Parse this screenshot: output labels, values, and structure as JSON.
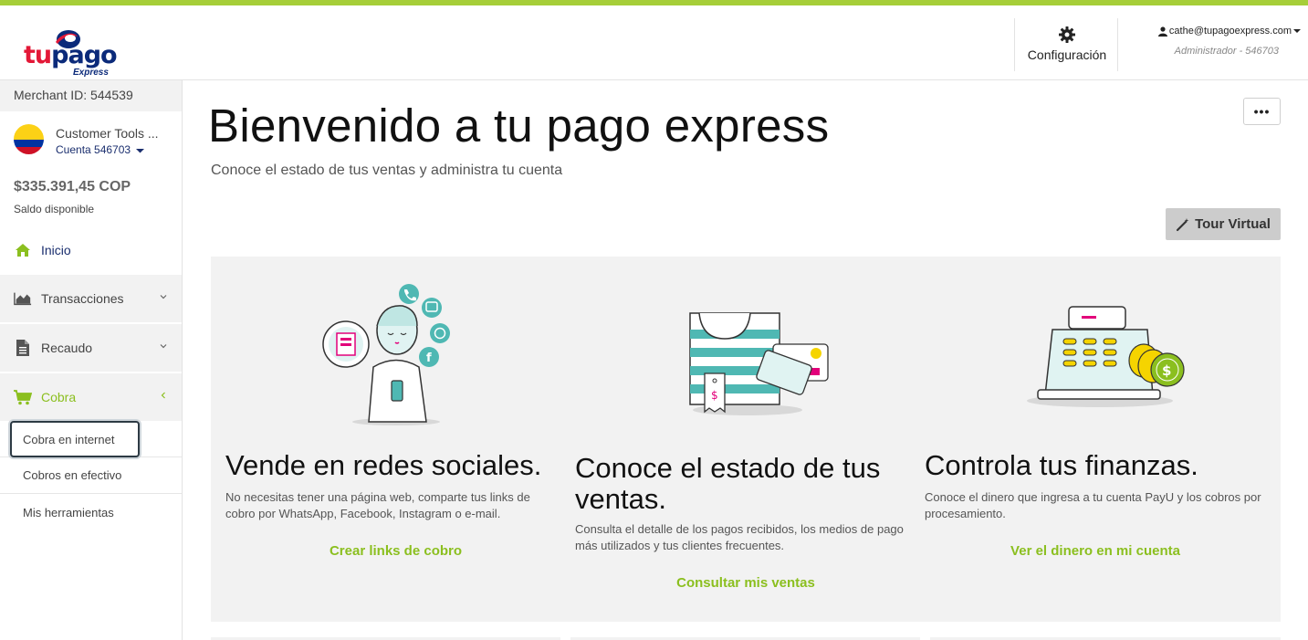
{
  "colors": {
    "accent": "#a6ce39",
    "brand_green": "#8bbf1f",
    "brand_navy": "#1a2e6e",
    "logo_red": "#e31837",
    "teal": "#4fb8b3"
  },
  "header": {
    "logo": {
      "tu": "tu",
      "pago": "pago",
      "express": "Express"
    },
    "config_label": "Configuración",
    "user_email": "cathe@tupagoexpress.com",
    "user_role": "Administrador - 546703"
  },
  "sidebar": {
    "merchant": "Merchant ID: 544539",
    "account_name": "Customer Tools ...",
    "account_number": "Cuenta  546703",
    "balance": "$335.391,45 COP",
    "balance_label": "Saldo disponible",
    "nav": [
      {
        "label": "Inicio",
        "icon": "home-icon"
      },
      {
        "label": "Transacciones",
        "icon": "area-chart-icon"
      },
      {
        "label": "Recaudo",
        "icon": "document-icon"
      },
      {
        "label": "Cobra",
        "icon": "cart-icon"
      }
    ],
    "sub_items": [
      {
        "label": "Cobra en internet"
      },
      {
        "label": "Cobros en efectivo"
      },
      {
        "label": "Mis herramientas"
      }
    ]
  },
  "main": {
    "title": "Bienvenido a tu pago express",
    "subtitle": "Conoce el estado de tus ventas y administra tu cuenta",
    "more_label": "•••",
    "tour_label": "Tour Virtual"
  },
  "cards": [
    {
      "title": "Vende en redes sociales.",
      "text": "No necesitas tener una página web, comparte tus links de cobro por WhatsApp, Facebook, Instagram o e-mail.",
      "cta": "Crear links de cobro",
      "illustration": "social-media-illustration"
    },
    {
      "title": "Conoce el estado de tus ventas.",
      "text": "Consulta el detalle de los pagos recibidos, los medios de pago más utilizados y tus clientes frecuentes.",
      "cta": "Consultar mis ventas",
      "illustration": "shopping-bag-illustration"
    },
    {
      "title": "Controla tus finanzas.",
      "text": "Conoce el dinero que ingresa a tu cuenta PayU y los cobros por procesamiento.",
      "cta": "Ver el dinero en mi cuenta",
      "illustration": "cash-register-illustration"
    }
  ]
}
